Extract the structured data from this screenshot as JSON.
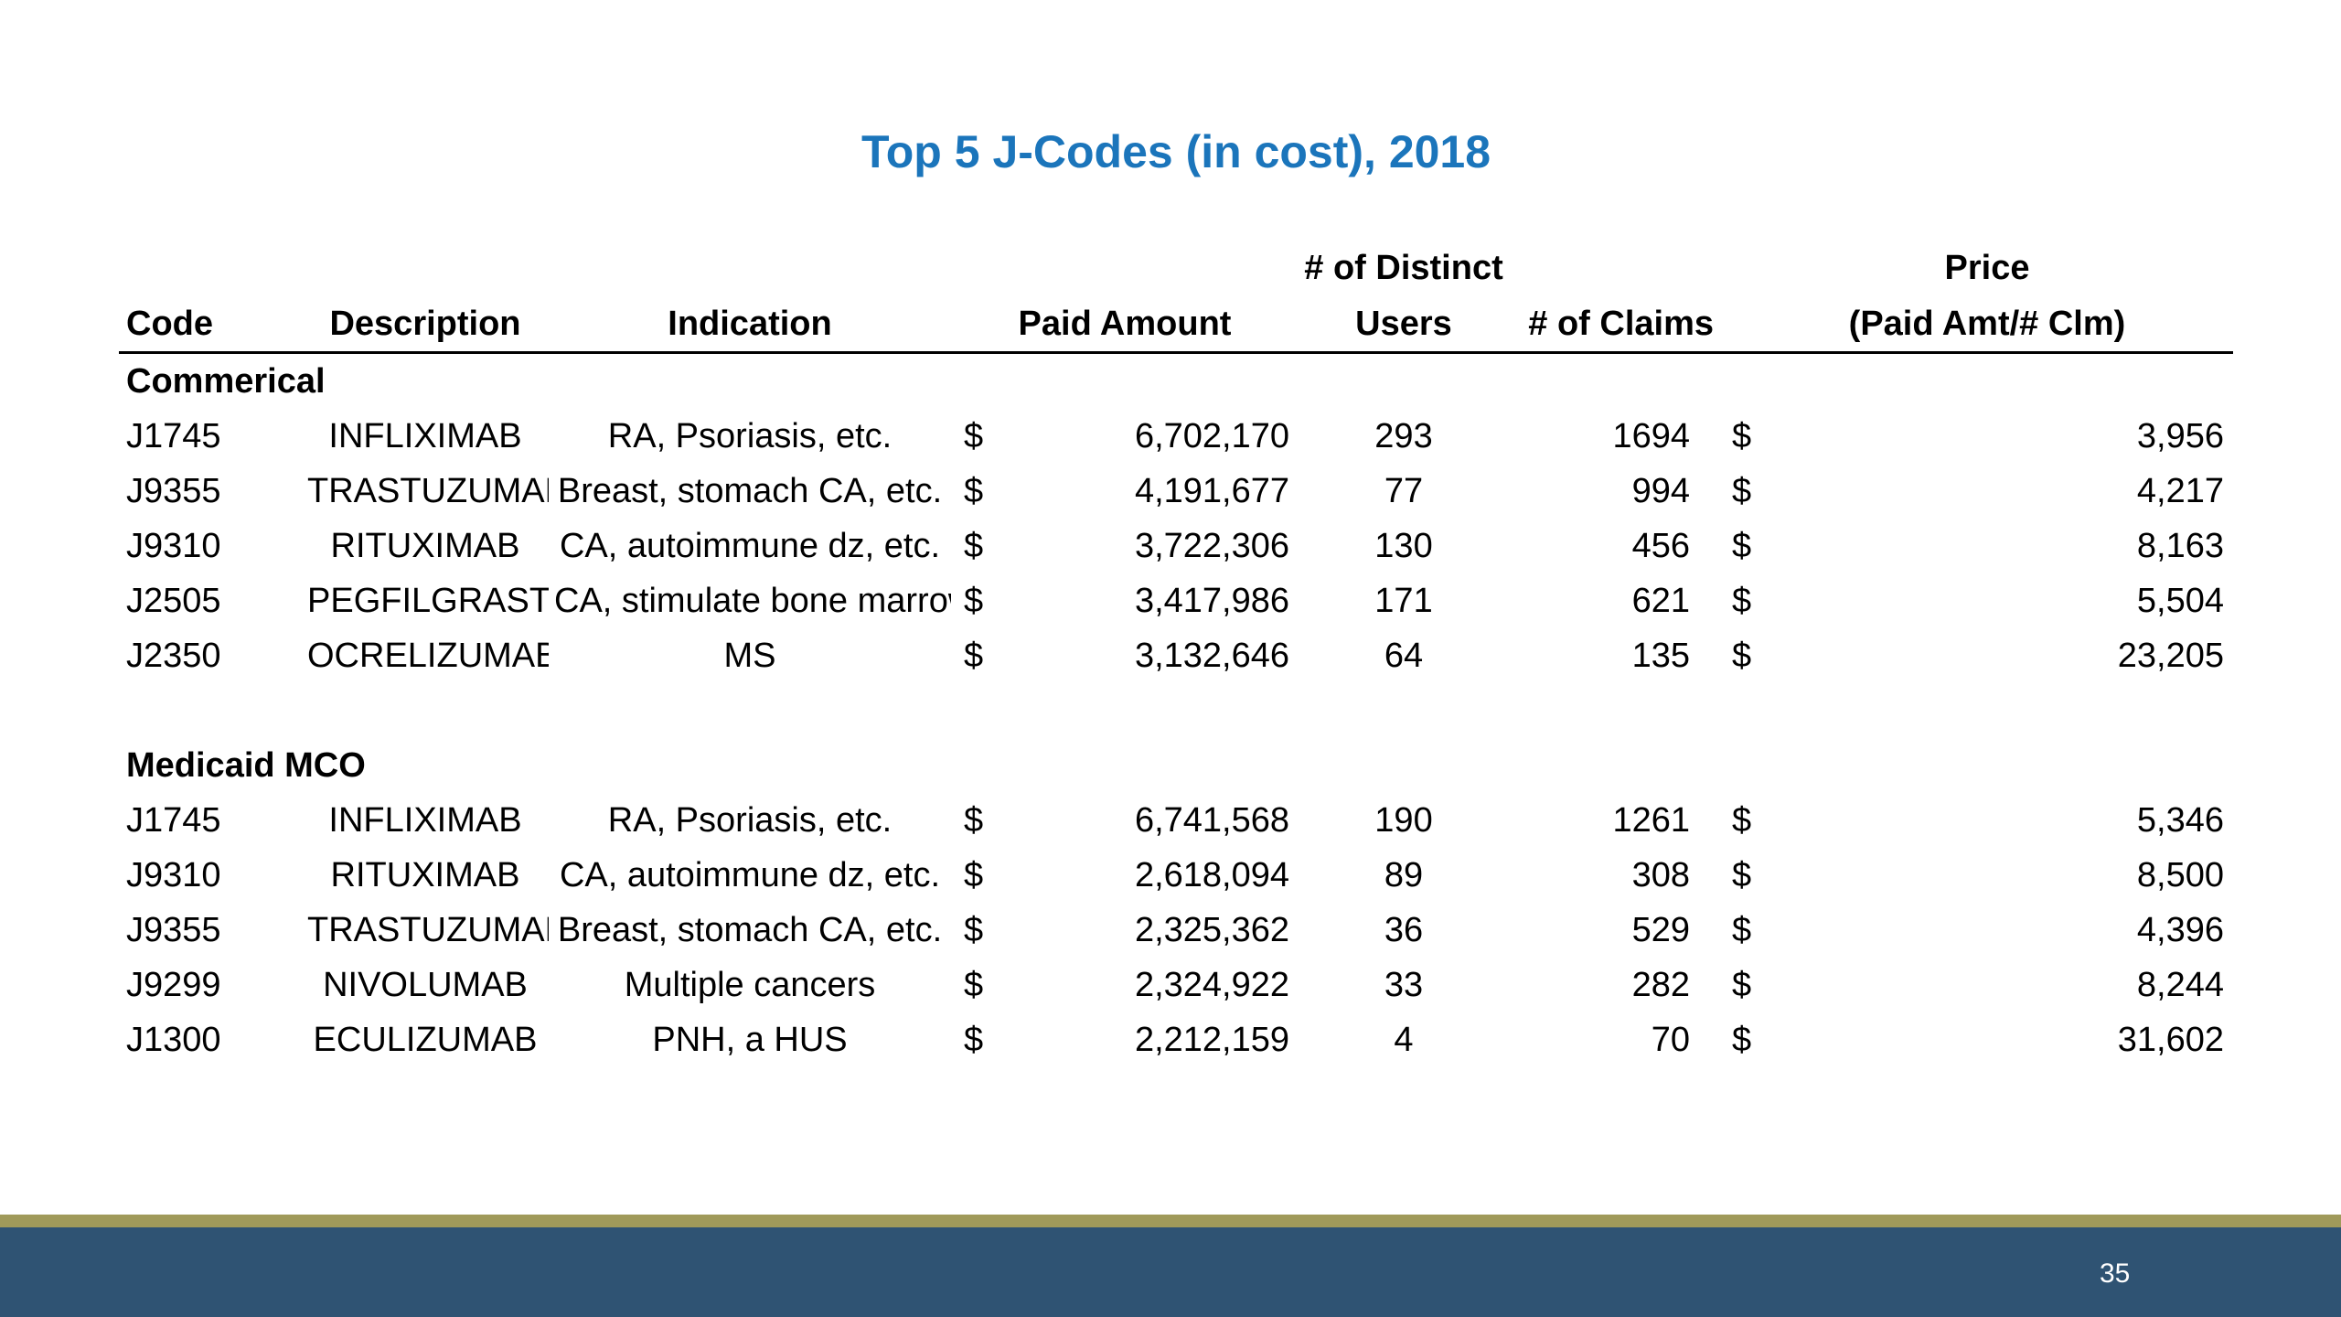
{
  "slide": {
    "title": "Top 5 J-Codes (in cost), 2018",
    "page_number": "35"
  },
  "colors": {
    "title": "#1b75bb",
    "footer_bar": "#2f5373",
    "footer_stripe": "#a09a5a"
  },
  "table": {
    "header": {
      "code": "Code",
      "description": "Description",
      "indication": "Indication",
      "paid_amount": "Paid Amount",
      "users_line1": "# of Distinct",
      "users_line2": "Users",
      "claims": "# of Claims",
      "price_line1": "Price",
      "price_line2": "(Paid Amt/# Clm)"
    },
    "sections": [
      {
        "label": "Commerical",
        "rows": [
          {
            "code": "J1745",
            "description": "INFLIXIMAB",
            "indication": "RA, Psoriasis, etc.",
            "paid_currency": "$",
            "paid_amount": "6,702,170",
            "users": "293",
            "claims": "1694",
            "price_currency": "$",
            "price": "3,956"
          },
          {
            "code": "J9355",
            "description": "TRASTUZUMAB",
            "indication": "Breast, stomach CA, etc.",
            "paid_currency": "$",
            "paid_amount": "4,191,677",
            "users": "77",
            "claims": "994",
            "price_currency": "$",
            "price": "4,217"
          },
          {
            "code": "J9310",
            "description": "RITUXIMAB",
            "indication": "CA, autoimmune dz, etc.",
            "paid_currency": "$",
            "paid_amount": "3,722,306",
            "users": "130",
            "claims": "456",
            "price_currency": "$",
            "price": "8,163"
          },
          {
            "code": "J2505",
            "description": "PEGFILGRASTIM",
            "indication": "CA, stimulate bone marrow",
            "paid_currency": "$",
            "paid_amount": "3,417,986",
            "users": "171",
            "claims": "621",
            "price_currency": "$",
            "price": "5,504"
          },
          {
            "code": "J2350",
            "description": "OCRELIZUMAB",
            "indication": "MS",
            "paid_currency": "$",
            "paid_amount": "3,132,646",
            "users": "64",
            "claims": "135",
            "price_currency": "$",
            "price": "23,205"
          }
        ]
      },
      {
        "label": "Medicaid MCO",
        "rows": [
          {
            "code": "J1745",
            "description": "INFLIXIMAB",
            "indication": "RA, Psoriasis, etc.",
            "paid_currency": "$",
            "paid_amount": "6,741,568",
            "users": "190",
            "claims": "1261",
            "price_currency": "$",
            "price": "5,346"
          },
          {
            "code": "J9310",
            "description": "RITUXIMAB",
            "indication": "CA, autoimmune dz, etc.",
            "paid_currency": "$",
            "paid_amount": "2,618,094",
            "users": "89",
            "claims": "308",
            "price_currency": "$",
            "price": "8,500"
          },
          {
            "code": "J9355",
            "description": "TRASTUZUMAB",
            "indication": "Breast, stomach CA, etc.",
            "paid_currency": "$",
            "paid_amount": "2,325,362",
            "users": "36",
            "claims": "529",
            "price_currency": "$",
            "price": "4,396"
          },
          {
            "code": "J9299",
            "description": "NIVOLUMAB",
            "indication": "Multiple cancers",
            "paid_currency": "$",
            "paid_amount": "2,324,922",
            "users": "33",
            "claims": "282",
            "price_currency": "$",
            "price": "8,244"
          },
          {
            "code": "J1300",
            "description": "ECULIZUMAB",
            "indication": "PNH, a HUS",
            "paid_currency": "$",
            "paid_amount": "2,212,159",
            "users": "4",
            "claims": "70",
            "price_currency": "$",
            "price": "31,602"
          }
        ]
      }
    ]
  }
}
